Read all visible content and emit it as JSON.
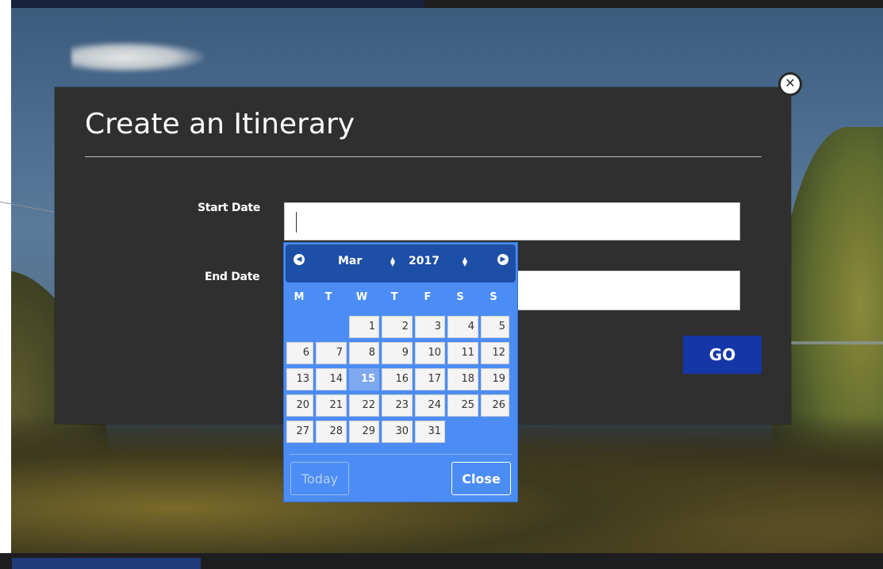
{
  "dialog": {
    "title": "Create an Itinerary",
    "close_icon": "close-circle-icon",
    "start_label": "Start Date",
    "end_label": "End Date",
    "start_value": "",
    "end_value": "",
    "go_label": "GO",
    "colors": {
      "background": "#2f2f2f",
      "go_button": "#1436a6"
    }
  },
  "datepicker": {
    "month": "Mar",
    "year": "2017",
    "prev_icon": "chevron-left-circle-icon",
    "next_icon": "chevron-right-circle-icon",
    "weekdays": [
      "M",
      "T",
      "W",
      "T",
      "F",
      "S",
      "S"
    ],
    "first_weekday_index": 2,
    "days_in_month": 31,
    "selected_day": 15,
    "today_label": "Today",
    "close_label": "Close",
    "colors": {
      "body": "#4c8df5",
      "header": "#1e4fa6",
      "selected": "#7fa8ee"
    }
  }
}
